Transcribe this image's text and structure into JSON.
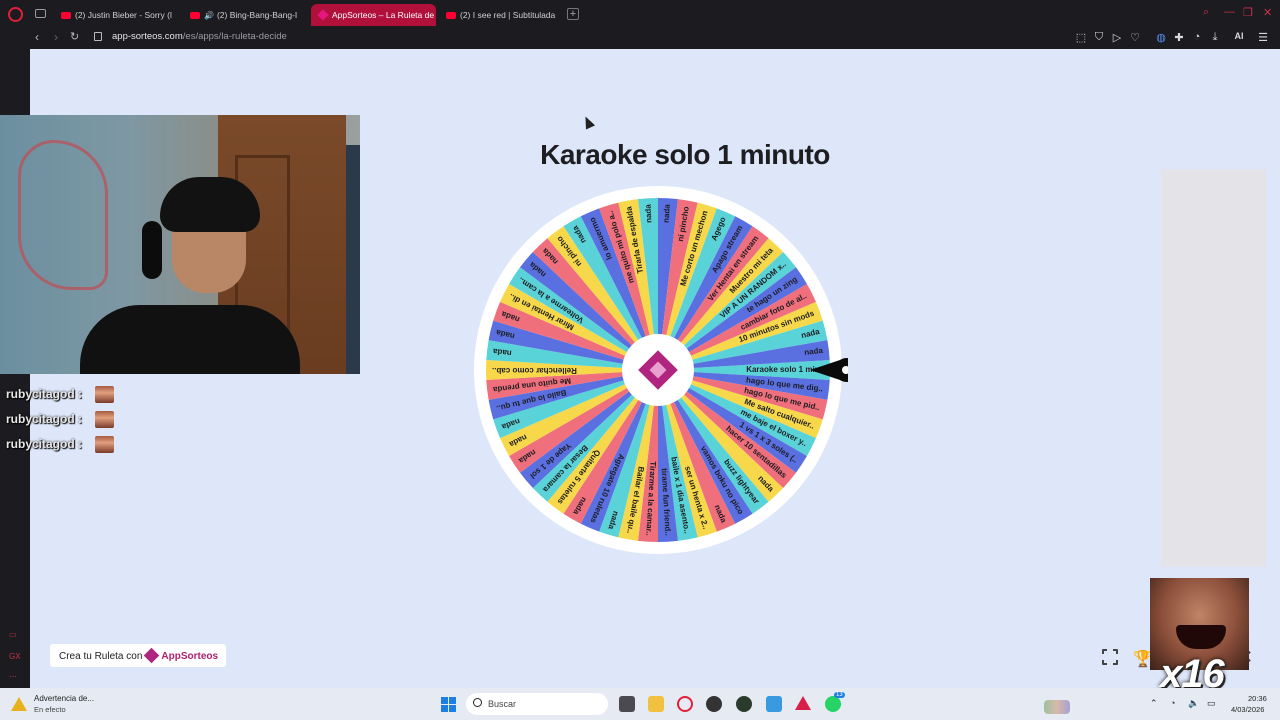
{
  "browser": {
    "tabs": [
      {
        "label": "(2) Justin Bieber - Sorry (l",
        "kind": "youtube"
      },
      {
        "label": "(2) Bing-Bang-Bang-I",
        "kind": "youtube-audio"
      },
      {
        "label": "AppSorteos – La Ruleta de",
        "kind": "app",
        "active": true
      },
      {
        "label": "(2) I see red | Subtitulada",
        "kind": "youtube"
      }
    ],
    "url_host": "app-sorteos.com",
    "url_path": "/es/apps/la-ruleta-decide",
    "ai_label": "AI"
  },
  "page": {
    "title": "Karaoke solo 1 minuto",
    "create_label": "Crea tu Ruleta con",
    "brand_label": "AppSorteos"
  },
  "wheel": {
    "colors": [
      "#5ad3d8",
      "#5a6fe0",
      "#ef6f7c",
      "#f7d84a"
    ],
    "segments": [
      "Karaoke solo 1 min..",
      "hago lo que me dig..",
      "hago lo que me pid..",
      "Me salto cualquier..",
      "me baje el boxer y..",
      "1 vs 1 x 3 soles (..",
      "hacer 10 sentadillas",
      "nada",
      "buzz lightyear",
      "vamos boku no pico",
      "nada",
      "ser un henta x 2..",
      "baile x 1 dia asento..",
      "tirame fun friend..",
      "Tirarme a la camar..",
      "Bailar el baile qu..",
      "nada",
      "Agregate 10 ruletas",
      "nada",
      "Quitarte 5 ruletas",
      "Besar la camara",
      "Yape de 1 sol",
      "nada",
      "nada",
      "nada",
      "Bailo lo que tu qu..",
      "Me quito una prenda",
      "Rellenchar como cab..",
      "nada",
      "nada",
      "nada",
      "Mirar Hentai en di..",
      "Voltearme a la cam..",
      "nada",
      "nada",
      "ni pincho",
      "nada",
      "lo amuermo",
      "me quito mi polo a..",
      "Tirarla de espalda",
      "nada",
      "nada",
      "ni pincho",
      "Me corto un mechon",
      "Agego",
      "Apago stream",
      "Ver Hentai en stream",
      "Muestro mi teta",
      "VIP A UN RANDOM x..",
      "te hago un zing",
      "cambiar foto de al..",
      "10 minutos sin mods",
      "nada",
      "nada"
    ]
  },
  "stream": {
    "chat": [
      {
        "user": "rubycitagod",
        "sep": ":"
      },
      {
        "user": "rubycitagod",
        "sep": ":"
      },
      {
        "user": "rubycitagod",
        "sep": ":"
      }
    ],
    "emote_multiplier": "x16"
  },
  "taskbar": {
    "warning_title": "Advertencia de...",
    "warning_sub": "En efecto",
    "search_placeholder": "Buscar",
    "time": "20:36",
    "date": "4/03/2026",
    "badge": "13"
  }
}
